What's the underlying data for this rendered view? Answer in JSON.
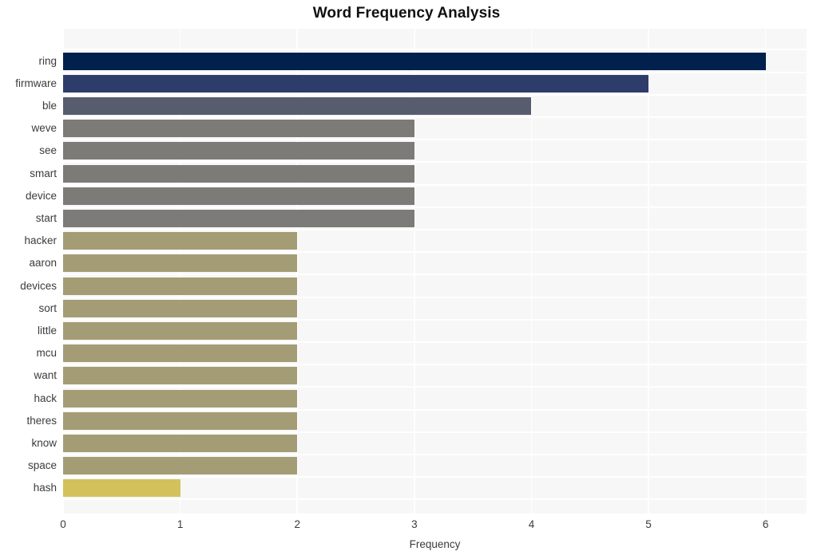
{
  "chart_data": {
    "type": "bar",
    "orientation": "horizontal",
    "title": "Word Frequency Analysis",
    "xlabel": "Frequency",
    "ylabel": "",
    "xlim": [
      0,
      6.35
    ],
    "xticks": [
      0,
      1,
      2,
      3,
      4,
      5,
      6
    ],
    "xtick_labels": [
      "0",
      "1",
      "2",
      "3",
      "4",
      "5",
      "6"
    ],
    "grid": true,
    "legend": null,
    "categories": [
      "ring",
      "firmware",
      "ble",
      "weve",
      "see",
      "smart",
      "device",
      "start",
      "hacker",
      "aaron",
      "devices",
      "sort",
      "little",
      "mcu",
      "want",
      "hack",
      "theres",
      "know",
      "space",
      "hash"
    ],
    "values": [
      6,
      5,
      4,
      3,
      3,
      3,
      3,
      3,
      2,
      2,
      2,
      2,
      2,
      2,
      2,
      2,
      2,
      2,
      2,
      1
    ],
    "bar_colors": [
      "#00204d",
      "#2d3c6b",
      "#575c6e",
      "#7c7b78",
      "#7c7b78",
      "#7c7b78",
      "#7c7b78",
      "#7c7b78",
      "#a49c74",
      "#a49c74",
      "#a49c74",
      "#a49c74",
      "#a49c74",
      "#a49c74",
      "#a49c74",
      "#a49c74",
      "#a49c74",
      "#a49c74",
      "#a49c74",
      "#d3c15c"
    ],
    "plot_background": "#f7f7f7",
    "grid_color": "#ffffff",
    "figure_background": "#ffffff",
    "text_color": "#3b3b3b",
    "title_color": "#111111"
  }
}
